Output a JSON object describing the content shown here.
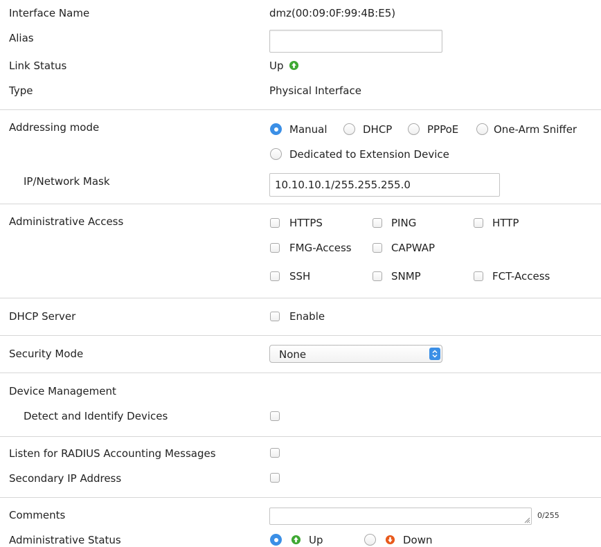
{
  "interface": {
    "name_label": "Interface Name",
    "name_value": "dmz(00:09:0F:99:4B:E5)",
    "alias_label": "Alias",
    "alias_value": "",
    "link_status_label": "Link Status",
    "link_status_value": "Up",
    "type_label": "Type",
    "type_value": "Physical Interface"
  },
  "addressing": {
    "label": "Addressing mode",
    "options": [
      "Manual",
      "DHCP",
      "PPPoE",
      "One-Arm Sniffer",
      "Dedicated to Extension Device"
    ],
    "selected": "Manual",
    "ip_mask_label": "IP/Network Mask",
    "ip_mask_value": "10.10.10.1/255.255.255.0"
  },
  "admin_access": {
    "label": "Administrative Access",
    "options": [
      "HTTPS",
      "PING",
      "HTTP",
      "FMG-Access",
      "CAPWAP",
      "SSH",
      "SNMP",
      "FCT-Access"
    ]
  },
  "dhcp_server": {
    "label": "DHCP Server",
    "enable_label": "Enable"
  },
  "security_mode": {
    "label": "Security Mode",
    "value": "None"
  },
  "device_management": {
    "label": "Device Management",
    "detect_label": "Detect and Identify Devices"
  },
  "radius": {
    "label": "Listen for RADIUS Accounting Messages"
  },
  "secondary_ip": {
    "label": "Secondary IP Address"
  },
  "comments": {
    "label": "Comments",
    "value": "",
    "counter": "0/255"
  },
  "admin_status": {
    "label": "Administrative Status",
    "up_label": "Up",
    "down_label": "Down",
    "selected": "Up"
  },
  "colors": {
    "accent": "#3b8fe6",
    "up_green": "#3ea832",
    "down_orange": "#e8591b",
    "divider": "#d6d6d6"
  }
}
